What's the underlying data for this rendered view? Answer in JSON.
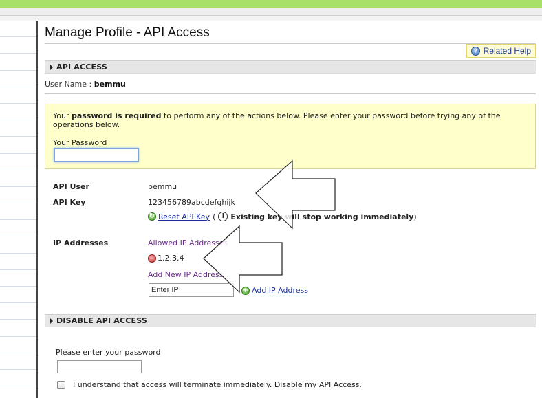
{
  "page": {
    "title": "Manage Profile - API Access"
  },
  "related_help": {
    "label": "Related Help"
  },
  "api_access_section": {
    "header": "API ACCESS",
    "username_label": "User Name :",
    "username_value": "bemmu"
  },
  "password_notice": {
    "text_before": "Your ",
    "text_bold": "password is required",
    "text_after": " to perform any of the actions below. Please enter your password before trying any of the operations below.",
    "field_label": "Your Password",
    "field_value": ""
  },
  "api_details": {
    "api_user_label": "API User",
    "api_user_value": "bemmu",
    "api_key_label": "API Key",
    "api_key_value": "123456789abcdefghijk",
    "reset_link": "Reset API Key",
    "open_paren": "(",
    "reset_warning": "Existing key will stop working immediately",
    "close_paren": ")"
  },
  "ip_addresses": {
    "label": "IP Addresses",
    "allowed_heading": "Allowed IP Addresses",
    "allowed": [
      "1.2.3.4"
    ],
    "add_heading": "Add New IP Address",
    "input_placeholder": "Enter IP",
    "add_link": "Add IP Address"
  },
  "disable_section": {
    "header": "DISABLE API ACCESS",
    "password_label": "Please enter your password",
    "confirm_label": "I understand that access will terminate immediately. Disable my API Access."
  },
  "colors": {
    "top_bar": "#a9e06a",
    "notice_bg": "#ffffcc",
    "link": "#1b2f9c",
    "purple_heading": "#6b2d8c"
  }
}
